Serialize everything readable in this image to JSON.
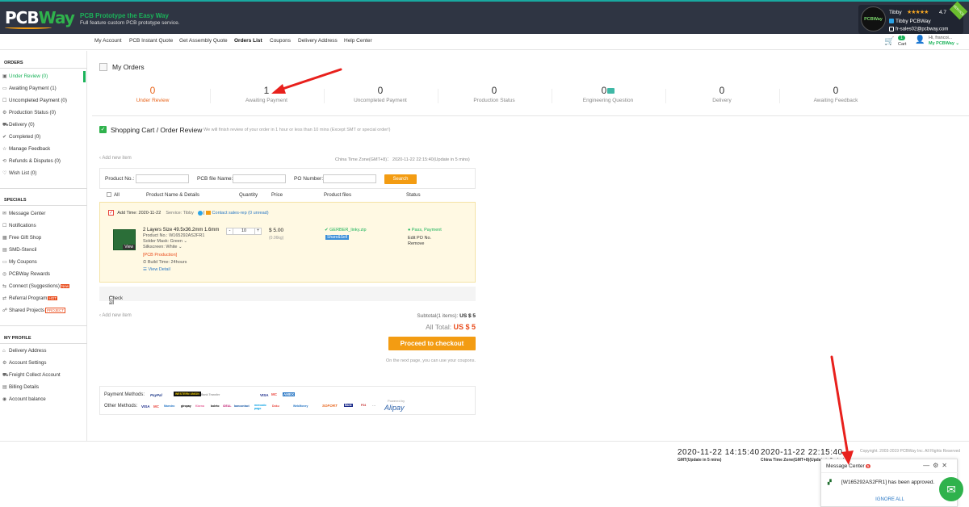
{
  "header": {
    "logo_text_a": "PCB",
    "logo_text_b": "Way",
    "tagline": "PCB Prototype the Easy Way",
    "subtagline": "Full feature custom PCB prototype service.",
    "user_name": "Tibby",
    "stars": "★★★★★",
    "rating": "4.7",
    "user_display": "Tibby PCBWay",
    "user_email": "fr-sales02@pcbway.com",
    "avatar_text": "PCBWay",
    "service_tag": "SERVICE"
  },
  "nav": {
    "items": [
      "My Account",
      "PCB Instant Quote",
      "Get Assembly Quote",
      "Orders List",
      "Coupons",
      "Delivery Address",
      "Help Center"
    ],
    "cart_count": "1",
    "cart_label": "Cart",
    "greeting": "Hi, francoi...",
    "my_pcbway": "My PCBWay ⌄"
  },
  "sidebar": {
    "orders_heading": "ORDERS",
    "orders": [
      {
        "label": "Under Review (0)",
        "icon": "▣"
      },
      {
        "label": "Awaiting Payment (1)",
        "icon": "▭"
      },
      {
        "label": "Uncompleted Payment (0)",
        "icon": "☐"
      },
      {
        "label": "Production Status (0)",
        "icon": "⚙"
      },
      {
        "label": "Delivery (0)",
        "icon": "⛟"
      },
      {
        "label": "Completed (0)",
        "icon": "✔"
      },
      {
        "label": "Manage Feedback",
        "icon": "☆"
      },
      {
        "label": "Refunds & Disputes (0)",
        "icon": "⟲"
      },
      {
        "label": "Wish List (0)",
        "icon": "♡"
      }
    ],
    "specials_heading": "SPECIALS",
    "specials": [
      {
        "label": "Message Center",
        "icon": "✉"
      },
      {
        "label": "Notifications",
        "icon": "☐"
      },
      {
        "label": "Free Gift Shop",
        "icon": "▦"
      },
      {
        "label": "SMD-Stencil",
        "icon": "▤"
      },
      {
        "label": "My Coupons",
        "icon": "▭"
      },
      {
        "label": "PCBWay Rewards",
        "icon": "◎"
      },
      {
        "label": "Connect (Suggestions)",
        "icon": "⇆",
        "badge": "New"
      },
      {
        "label": "Referral Program",
        "icon": "⇄",
        "badge": "HOT"
      },
      {
        "label": "Shared Projects",
        "icon": "☍",
        "badge": "PROJECT"
      }
    ],
    "profile_heading": "MY PROFILE",
    "profile": [
      {
        "label": "Delivery Address",
        "icon": "⌂"
      },
      {
        "label": "Account Settings",
        "icon": "⚙"
      },
      {
        "label": "Freight Collect Account",
        "icon": "⛟"
      },
      {
        "label": "Billing Details",
        "icon": "▤"
      },
      {
        "label": "Account balance",
        "icon": "◉"
      }
    ]
  },
  "my_orders": {
    "title": "My Orders",
    "stats": [
      {
        "count": "0",
        "label": "Under Review"
      },
      {
        "count": "1",
        "label": "Awaiting Payment"
      },
      {
        "count": "0",
        "label": "Uncompleted Payment"
      },
      {
        "count": "0",
        "label": "Production Status"
      },
      {
        "count": "0",
        "label": "Engineering Question"
      },
      {
        "count": "0",
        "label": "Delivery"
      },
      {
        "count": "0",
        "label": "Awaiting Feedback"
      }
    ]
  },
  "cart": {
    "title": "Shopping Cart / Order Review",
    "subtitle": "We will finish review of your order in 1 hour or less than 10 mins (Except SMT or special order!)",
    "add_new": "‹ Add new item",
    "timezone": "China Time Zone(GMT+8)： 2020-11-22 22:15:40(Update in 5 mins)",
    "search": {
      "product_no_label": "Product No.:",
      "pcb_file_label": "PCB file Name:",
      "po_label": "PO Number:",
      "button": "Search"
    },
    "columns": [
      "All",
      "Product Name & Details",
      "Quantity",
      "Price",
      "Product files",
      "Status"
    ],
    "item": {
      "add_time": "Add Time: 2020-11-22",
      "service": "Service: Tibby",
      "contact": "Contact sales-rep (0 unread)",
      "thumb_label": "View",
      "line1": "2 Layers Size 49.5x36.2mm 1.6mm",
      "product_no": "Product No.: W165292AS2FR1",
      "solder_mask": "Solder Mask: Green ⌄",
      "silkscreen": "Silkscreen: White ⌄",
      "category": "[PCB Production]",
      "build_time": "Build Time: 24hours",
      "view_detail": "View Detail",
      "qty": "10",
      "price": "$ 5.00",
      "weight": "(0.06kg)",
      "file": "✔ GERBER_linky.zip",
      "share": "Share&Sell",
      "status": "● Pass, Payment",
      "edit_po": "Edit PO No.",
      "remove": "Remove"
    },
    "check_all": "Check all",
    "subtotal_label": "Subtotal(1 items):",
    "subtotal_value": "US $ 5",
    "all_total_label": "All Total:",
    "all_total_value": "US $ 5",
    "checkout": "Proceed to checkout",
    "coupon_note": "On the next page, you can use your coupons.",
    "payment_methods_label": "Payment Methods:",
    "other_methods_label": "Other Methods:",
    "payment_logos": [
      "PayPal",
      "WESTERN UNION",
      "Bank Transfer",
      "VISA",
      "MC",
      "AMEX"
    ],
    "other_logos": [
      "VISA",
      "MC",
      "Maestro",
      "giropay",
      "Klarna",
      "boleto",
      "iDEAL",
      "bancontact",
      "mercado pago",
      "Doku",
      "WebMoney",
      "SOFORT",
      "Bank",
      "P24"
    ],
    "alipay": "Alipay",
    "powered_by": "Powered by"
  },
  "footer": {
    "gmt_time": "2020-11-22 14:15:40",
    "gmt_label": "GMT(Update in 5 mins)",
    "china_time": "2020-11-22 22:15:40",
    "china_label": "China Time Zone(GMT+8)(Update in 5 mins)",
    "copyright": "Copyright. 2003-2019 PCBWay Inc. All Rights Reserved"
  },
  "message_center": {
    "title": "Message Center",
    "badge": "5",
    "message": "[W165292AS2FR1] has been approved.",
    "ignore": "IGNORE ALL"
  },
  "colors": {
    "green": "#1bb35a",
    "orange": "#f39c12",
    "red": "#e94d1d",
    "header_bg": "#2f3543"
  }
}
